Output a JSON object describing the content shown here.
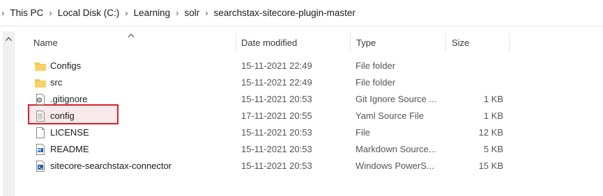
{
  "breadcrumb": [
    "This PC",
    "Local Disk (C:)",
    "Learning",
    "solr",
    "searchstax-sitecore-plugin-master"
  ],
  "columns": {
    "name": "Name",
    "date": "Date modified",
    "type": "Type",
    "size": "Size"
  },
  "files": [
    {
      "name": "Configs",
      "date": "15-11-2021 22:49",
      "type": "File folder",
      "size": "",
      "icon": "folder-icon"
    },
    {
      "name": "src",
      "date": "15-11-2021 22:49",
      "type": "File folder",
      "size": "",
      "icon": "folder-icon"
    },
    {
      "name": ".gitignore",
      "date": "15-11-2021 20:53",
      "type": "Git Ignore Source ...",
      "size": "1 KB",
      "icon": "gitignore-file-icon"
    },
    {
      "name": "config",
      "date": "17-11-2021 20:55",
      "type": "Yaml Source File",
      "size": "1 KB",
      "icon": "yaml-file-icon"
    },
    {
      "name": "LICENSE",
      "date": "15-11-2021 20:53",
      "type": "File",
      "size": "12 KB",
      "icon": "blank-file-icon"
    },
    {
      "name": "README",
      "date": "15-11-2021 20:53",
      "type": "Markdown Source...",
      "size": "5 KB",
      "icon": "markdown-file-icon"
    },
    {
      "name": "sitecore-searchstax-connector",
      "date": "15-11-2021 20:53",
      "type": "Windows PowerS...",
      "size": "15 KB",
      "icon": "powershell-file-icon"
    }
  ],
  "highlight_color": "#d8202a",
  "folder_color": "#f4c44a"
}
